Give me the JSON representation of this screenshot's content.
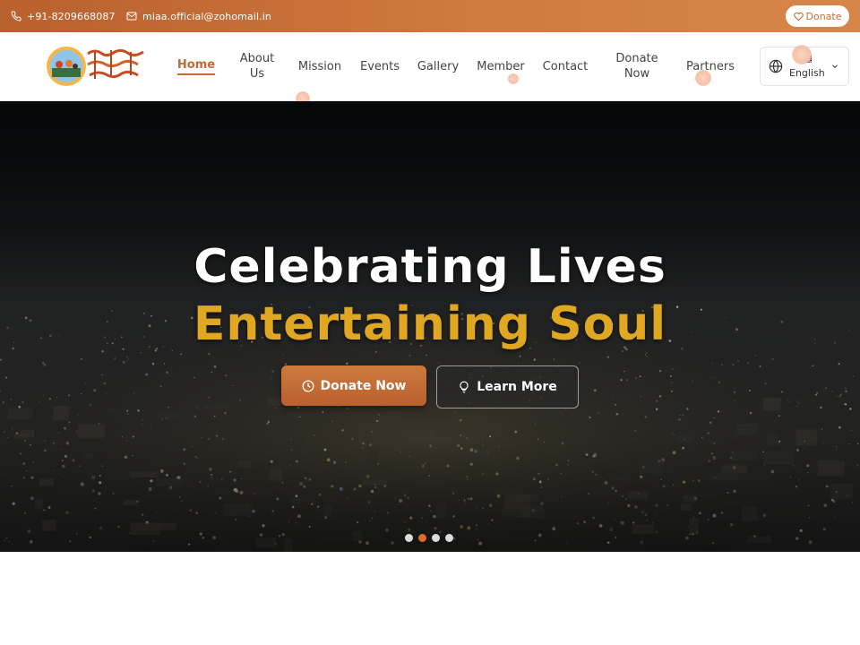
{
  "topbar": {
    "phone": "+91-8209668087",
    "email": "miaa.official@zohomail.in",
    "donate_label": "Donate",
    "accent": "#c56a34"
  },
  "nav": {
    "logo_alt": "logo",
    "items": [
      {
        "label": "Home",
        "active": true
      },
      {
        "label": "About\nUs"
      },
      {
        "label": "Mission"
      },
      {
        "label": "Events"
      },
      {
        "label": "Gallery"
      },
      {
        "label": "Member"
      },
      {
        "label": "Contact"
      },
      {
        "label": "Donate\nNow"
      },
      {
        "label": "Partners"
      }
    ],
    "language": {
      "label": "English",
      "flag": "uk-flag",
      "icon": "globe-icon"
    }
  },
  "hero": {
    "title_line1": "Celebrating Lives",
    "title_line2": "Entertaining Soul",
    "title_line2_color": "#e0a722",
    "donate_button": "Donate Now",
    "learn_button": "Learn More",
    "slides": {
      "count": 4,
      "active_index": 1
    }
  }
}
